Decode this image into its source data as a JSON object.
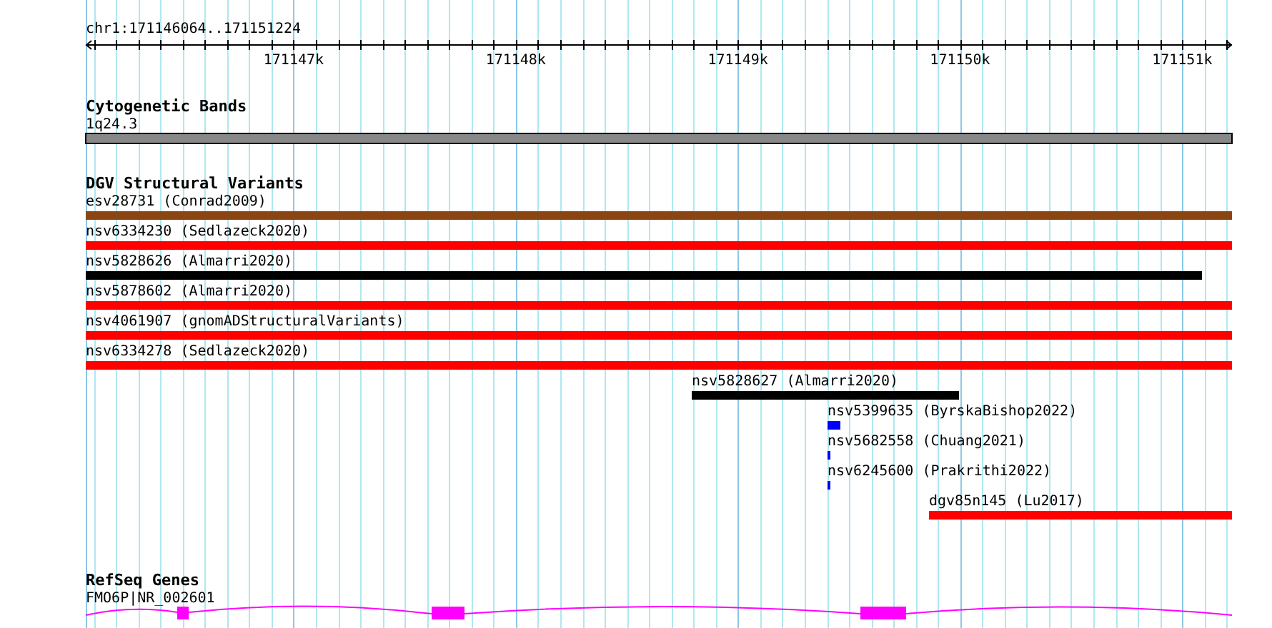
{
  "location": "chr1:171146064..171151224",
  "ruler": {
    "labels": [
      "171147k",
      "171148k",
      "171149k",
      "171150k",
      "171151k"
    ]
  },
  "tracks": [
    {
      "kind": "bands",
      "title": "Cytogenetic Bands",
      "features": [
        {
          "label": "1q24.3",
          "color": "#888888"
        }
      ]
    },
    {
      "kind": "variants",
      "title": "DGV Structural Variants",
      "features": [
        {
          "label": "esv28731 (Conrad2009)",
          "color": "#8b4513"
        },
        {
          "label": "nsv6334230 (Sedlazeck2020)",
          "color": "#ff0000"
        },
        {
          "label": "nsv5828626 (Almarri2020)",
          "color": "#000000"
        },
        {
          "label": "nsv5878602 (Almarri2020)",
          "color": "#ff0000"
        },
        {
          "label": "nsv4061907 (gnomADStructuralVariants)",
          "color": "#ff0000"
        },
        {
          "label": "nsv6334278 (Sedlazeck2020)",
          "color": "#ff0000"
        },
        {
          "label": "nsv5828627 (Almarri2020)",
          "color": "#000000"
        },
        {
          "label": "nsv5399635 (ByrskaBishop2022)",
          "color": "#0000ff"
        },
        {
          "label": "nsv5682558 (Chuang2021)",
          "color": "#0000ff"
        },
        {
          "label": "nsv6245600 (Prakrithi2022)",
          "color": "#0000ff"
        },
        {
          "label": "dgv85n145 (Lu2017)",
          "color": "#ff0000"
        }
      ]
    },
    {
      "kind": "genes",
      "title": "RefSeq Genes",
      "features": [
        {
          "label": "FMO6P|NR_002601",
          "color": "#ff00ff"
        }
      ]
    }
  ]
}
